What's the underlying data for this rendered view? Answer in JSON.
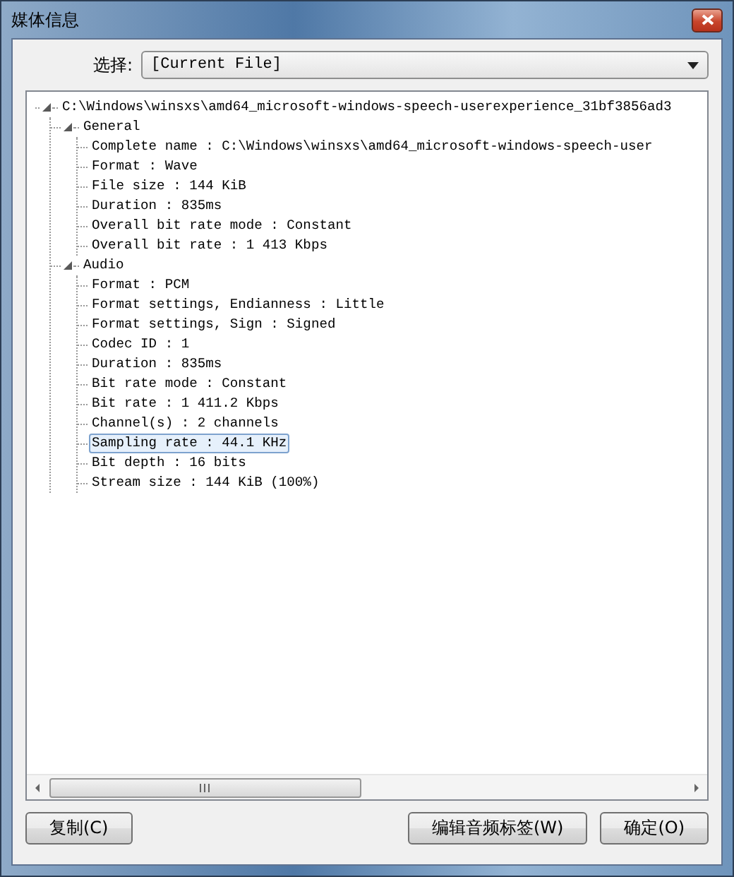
{
  "window": {
    "title": "媒体信息"
  },
  "selector": {
    "label": "选择:",
    "value": "[Current File]"
  },
  "tree": [
    {
      "label": "C:\\Windows\\winsxs\\amd64_microsoft-windows-speech-userexperience_31bf3856ad3",
      "expanded": true,
      "selected": false,
      "children": [
        {
          "label": "General",
          "expanded": true,
          "selected": false,
          "children": [
            {
              "label": "Complete name : C:\\Windows\\winsxs\\amd64_microsoft-windows-speech-user",
              "selected": false
            },
            {
              "label": "Format : Wave",
              "selected": false
            },
            {
              "label": "File size : 144 KiB",
              "selected": false
            },
            {
              "label": "Duration : 835ms",
              "selected": false
            },
            {
              "label": "Overall bit rate mode : Constant",
              "selected": false
            },
            {
              "label": "Overall bit rate : 1 413 Kbps",
              "selected": false
            }
          ]
        },
        {
          "label": "Audio",
          "expanded": true,
          "selected": false,
          "children": [
            {
              "label": "Format : PCM",
              "selected": false
            },
            {
              "label": "Format settings, Endianness : Little",
              "selected": false
            },
            {
              "label": "Format settings, Sign : Signed",
              "selected": false
            },
            {
              "label": "Codec ID : 1",
              "selected": false
            },
            {
              "label": "Duration : 835ms",
              "selected": false
            },
            {
              "label": "Bit rate mode : Constant",
              "selected": false
            },
            {
              "label": "Bit rate : 1 411.2 Kbps",
              "selected": false
            },
            {
              "label": "Channel(s) : 2 channels",
              "selected": false
            },
            {
              "label": "Sampling rate : 44.1 KHz",
              "selected": true
            },
            {
              "label": "Bit depth : 16 bits",
              "selected": false
            },
            {
              "label": "Stream size : 144 KiB (100%)",
              "selected": false
            }
          ]
        }
      ]
    }
  ],
  "buttons_left": [
    {
      "label": "复制(C)"
    }
  ],
  "buttons_right": [
    {
      "label": "编辑音频标签(W)"
    },
    {
      "label": "确定(O)"
    }
  ]
}
